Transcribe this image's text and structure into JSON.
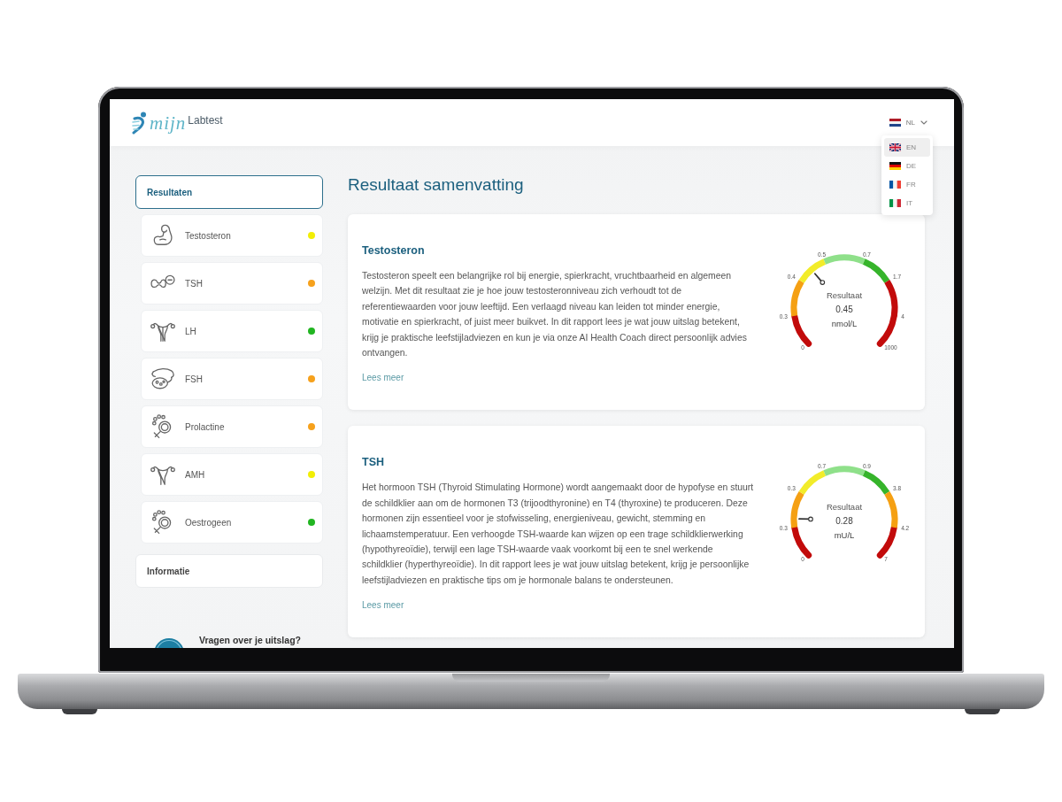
{
  "header": {
    "logo": {
      "script": "mijn",
      "text": "Labtest"
    },
    "language": {
      "current": "NL",
      "expanded": true,
      "options": [
        {
          "code": "EN",
          "highlighted": true
        },
        {
          "code": "DE",
          "highlighted": false
        },
        {
          "code": "FR",
          "highlighted": false
        },
        {
          "code": "IT",
          "highlighted": false
        }
      ]
    }
  },
  "sidebar": {
    "items": [
      {
        "label": "Resultaten",
        "selected": true,
        "children": [
          {
            "label": "Testosteron",
            "color": "#f2ee05"
          },
          {
            "label": "TSH",
            "color": "#f6a11c"
          },
          {
            "label": "LH",
            "color": "#21b521"
          },
          {
            "label": "FSH",
            "color": "#f6a11c"
          },
          {
            "label": "Prolactine",
            "color": "#f6a11c"
          },
          {
            "label": "AMH",
            "color": "#f2ee05"
          },
          {
            "label": "Oestrogeen",
            "color": "#21b521"
          }
        ]
      },
      {
        "label": "Informatie",
        "selected": false
      }
    ],
    "help": {
      "text": "Vragen over je uitslag?"
    }
  },
  "main": {
    "title": "Resultaat samenvatting",
    "cards": [
      {
        "title": "Testosteron",
        "text": "Testosteron speelt een belangrijke rol bij energie, spierkracht, vruchtbaarheid en algemeen welzijn. Met dit resultaat zie je hoe jouw testosteronniveau zich verhoudt tot de referentiewaarden voor jouw leeftijd. Een verlaagd niveau kan leiden tot minder energie, motivatie en spierkracht, of juist meer buikvet. In dit rapport lees je wat jouw uitslag betekent, krijg je praktische leefstijladviezen en kun je via onze AI Health Coach direct persoonlijk advies ontvangen.",
        "link": "Lees meer",
        "gauge": {
          "caption": "Resultaat",
          "value": "0.45",
          "unit": "nmol/L",
          "level": 0.35,
          "ticks": [
            "0",
            "0.3",
            "0.4",
            "0.5",
            "0.7",
            "1.7",
            "4",
            "1000"
          ],
          "segments": [
            {
              "color": "#c20b0b"
            },
            {
              "color": "#f5a013"
            },
            {
              "color": "#f2ec2a"
            },
            {
              "color": "#8fe08a"
            },
            {
              "color": "#36b42b"
            },
            {
              "color": "#c20b0b"
            },
            {
              "color": "#c20b0b"
            }
          ]
        }
      },
      {
        "title": "TSH",
        "text": "Het hormoon TSH (Thyroid Stimulating Hormone) wordt aangemaakt door de hypofyse en stuurt de schildklier aan om de hormonen T3 (trijoodthyronine) en T4 (thyroxine) te produceren. Deze hormonen zijn essentieel voor je stofwisseling, energieniveau, gewicht, stemming en lichaamstemperatuur. Een verhoogde TSH-waarde kan wijzen op een trage schildklierwerking (hypothyreoïdie), terwijl een lage TSH-waarde vaak voorkomt bij een te snel werkende schildklier (hyperthyreoïdie). In dit rapport lees je wat jouw uitslag betekent, krijg je persoonlijke leefstijladviezen en praktische tips om je hormonale balans te ondersteunen.",
        "link": "Lees meer",
        "gauge": {
          "caption": "Resultaat",
          "value": "0.28",
          "unit": "mU/L",
          "level": 0.17,
          "ticks": [
            "0",
            "0.3",
            "0.3",
            "0.7",
            "0.9",
            "3.8",
            "4.2",
            "7"
          ],
          "segments": [
            {
              "color": "#c20b0b"
            },
            {
              "color": "#f5a013"
            },
            {
              "color": "#f2ec2a"
            },
            {
              "color": "#8fe08a"
            },
            {
              "color": "#36b42b"
            },
            {
              "color": "#f5a013"
            },
            {
              "color": "#c20b0b"
            }
          ]
        }
      }
    ]
  }
}
